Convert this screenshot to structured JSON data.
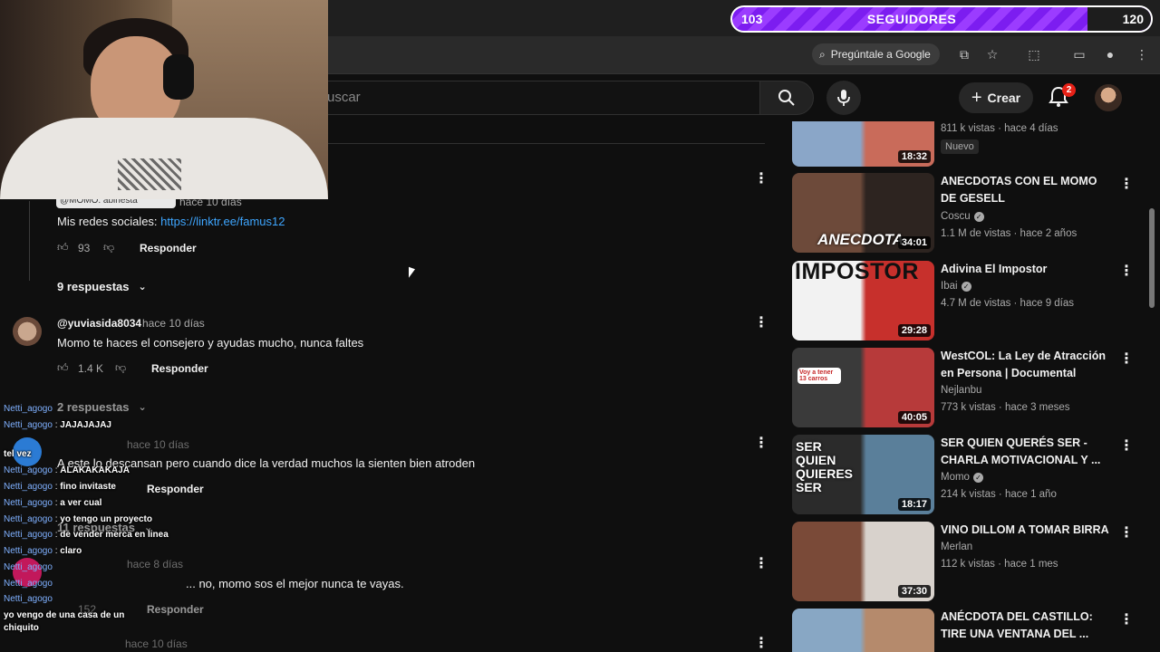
{
  "followers": {
    "current": "103",
    "label": "SEGUIDORES",
    "goal": "120"
  },
  "browser": {
    "ask_google": "Pregúntale a Google"
  },
  "header": {
    "search_placeholder": "Buscar",
    "search_visible": "uscar",
    "create_label": "Crear",
    "notifications": "2"
  },
  "comments": [
    {
      "author_badge": "@MOMO. abinesta",
      "time": "hace 10 días",
      "text_prefix": "Mis redes sociales:",
      "link": "https://linktr.ee/famus12",
      "likes": "93",
      "reply_label": "Responder",
      "replies": "9 respuestas"
    },
    {
      "author": "@yuviasida8034",
      "time": "hace 10 días",
      "text": "Momo te haces el consejero y ayudas mucho, nunca faltes",
      "likes": "1.4 K",
      "reply_label": "Responder",
      "replies": "2 respuestas"
    },
    {
      "author": "",
      "time": "hace 10 días",
      "text": "A este lo descansan pero cuando dice la verdad muchos la sienten bien atroden",
      "likes": "",
      "reply_label": "Responder",
      "replies": "11 respuestas"
    },
    {
      "author": "",
      "time": "hace 8 días",
      "text": "... no, momo sos el mejor nunca te vayas.",
      "likes": "152",
      "reply_label": "Responder"
    },
    {
      "author": "",
      "time": "hace 10 días",
      "text": ""
    }
  ],
  "chat": [
    {
      "user": "Netti_agogo",
      "msg": ""
    },
    {
      "user": "Netti_agogo",
      "msg": "JAJAJAJAJ"
    },
    {
      "user": "",
      "msg": "tel vez"
    },
    {
      "user": "Netti_agogo",
      "msg": "ALAKAKAKAJA"
    },
    {
      "user": "Netti_agogo",
      "msg": "fino invitaste"
    },
    {
      "user": "Netti_agogo",
      "msg": "a ver cual"
    },
    {
      "user": "Netti_agogo",
      "msg": "yo tengo un proyecto"
    },
    {
      "user": "Netti_agogo",
      "msg": "de vender merca en linea"
    },
    {
      "user": "Netti_agogo",
      "msg": "claro"
    },
    {
      "user": "Netti_agogo",
      "msg": ""
    },
    {
      "user": "Netti_agogo",
      "msg": ""
    },
    {
      "user": "Netti_agogo",
      "msg": ""
    },
    {
      "user": "Netti_agogo",
      "msg": "yo vengo de una casa de un"
    },
    {
      "user": "",
      "msg": "chiquito"
    }
  ],
  "videos": [
    {
      "title": "",
      "channel": "",
      "views": "811 k vistas · hace 4 días",
      "badge": "Nuevo",
      "duration": "18:32",
      "colors": [
        "#8aa6c8",
        "#c96b5a"
      ]
    },
    {
      "title": "ANECDOTAS CON EL MOMO DE GESELL",
      "channel": "Coscu",
      "views": "1.1 M de vistas · hace 2 años",
      "duration": "34:01",
      "thumb_text": "ANECDOTA",
      "colors": [
        "#6d4a3a",
        "#2d2420"
      ]
    },
    {
      "title": "Adivina El Impostor",
      "channel": "Ibai",
      "views": "4.7 M de vistas · hace 9 días",
      "duration": "29:28",
      "thumb_text": "IMPOSTOR",
      "colors": [
        "#f2f2f2",
        "#c7302c"
      ]
    },
    {
      "title": "WestCOL: La Ley de Atracción en Persona | Documental",
      "channel": "Nejlanbu",
      "views": "773 k vistas · hace 3 meses",
      "duration": "40:05",
      "thumb_text": "Voy a tener 13 carros",
      "colors": [
        "#3a3a3a",
        "#b73a3a"
      ]
    },
    {
      "title": "SER QUIEN QUERÉS SER - CHARLA MOTIVACIONAL Y ...",
      "channel": "Momo",
      "views": "214 k vistas · hace 1 año",
      "duration": "18:17",
      "thumb_text": "SER QUIEN QUIERES SER",
      "colors": [
        "#2b2b2b",
        "#5a7f9a"
      ]
    },
    {
      "title": "VINO DILLOM A TOMAR BIRRA",
      "channel": "Merlan",
      "views": "112 k vistas · hace 1 mes",
      "duration": "37:30",
      "colors": [
        "#7a4a38",
        "#d8d2cc"
      ]
    },
    {
      "title": "ANÉCDOTA DEL CASTILLO: TIRE UNA VENTANA DEL ...",
      "channel": "",
      "views": "",
      "duration": "",
      "colors": [
        "#88a7c4",
        "#b58a6c"
      ]
    }
  ]
}
